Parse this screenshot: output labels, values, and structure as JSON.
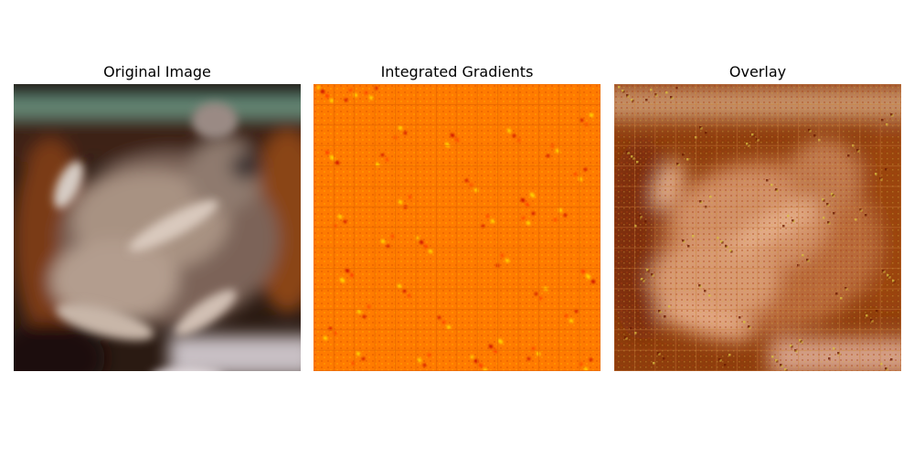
{
  "figure": {
    "panels": [
      {
        "title": "Original Image",
        "image": "frog-photo"
      },
      {
        "title": "Integrated Gradients",
        "image": "attribution-heatmap"
      },
      {
        "title": "Overlay",
        "image": "overlay-photo-heatmap"
      }
    ]
  },
  "colors": {
    "background": "#ffffff",
    "heatmap_base": "#ff7b00",
    "heatmap_hot": "#ffe000",
    "heatmap_cold": "#c60000",
    "overlay_tone": "#b75a1e",
    "frog_body": "#9c8576",
    "frog_dark": "#3e2a20",
    "bar_green": "#6a8f7c"
  }
}
